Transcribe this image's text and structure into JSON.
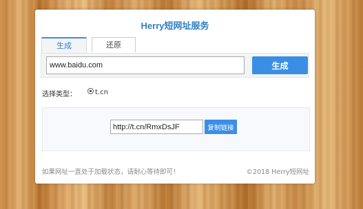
{
  "header": {
    "title": "Herry短网址服务"
  },
  "tabs": [
    {
      "label": "生成",
      "active": true
    },
    {
      "label": "还原",
      "active": false
    }
  ],
  "form": {
    "url_value": "www.baidu.com",
    "generate_label": "生成"
  },
  "type_select": {
    "label": "选择类型：",
    "options": [
      {
        "label": "t.cn",
        "selected": true
      }
    ]
  },
  "result": {
    "short_url": "http://t.cn/RmxDsJF",
    "copy_label": "复制链接"
  },
  "footer": {
    "notice": "如果网址一直处于加载状态，请耐心等待即可！",
    "copyright": "©2018  Herry短网址"
  },
  "colors": {
    "accent": "#3a8ee6",
    "title": "#2e7ec3"
  }
}
